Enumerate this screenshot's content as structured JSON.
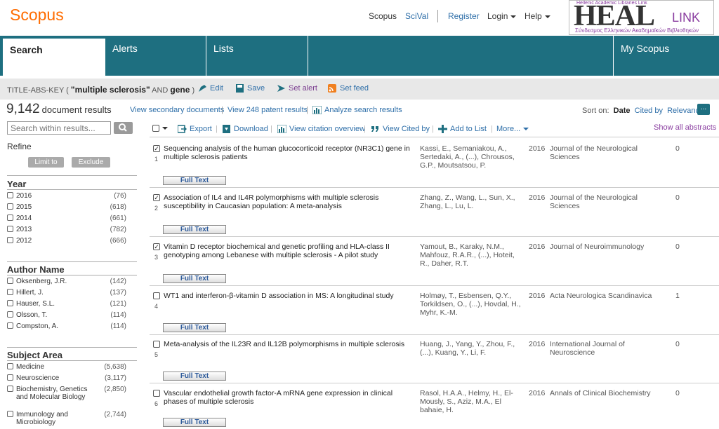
{
  "header": {
    "logo": "Scopus",
    "nav": {
      "scopus": "Scopus",
      "scival": "SciVal",
      "register": "Register",
      "login": "Login",
      "help": "Help"
    },
    "heal": {
      "top_text": "Hellenic Academic Libraries Link",
      "big": "HEAL",
      "link": "LINK",
      "sub": "Σύνδεσμος Ελληνικών Ακαδημαϊκών Βιβλιοθηκών"
    }
  },
  "navbar": {
    "search": "Search",
    "alerts": "Alerts",
    "lists": "Lists",
    "myscopus": "My Scopus"
  },
  "query": {
    "prefix": "TITLE-ABS-KEY",
    "term1": "\"multiple sclerosis\"",
    "operator": "AND",
    "term2": "gene",
    "edit": "Edit",
    "save": "Save",
    "set_alert": "Set alert",
    "set_feed": "Set feed"
  },
  "results": {
    "count": "9,142",
    "label": "document results",
    "secondary": "View secondary documents",
    "patents": "View 248 patent results",
    "analyze": "Analyze search results",
    "sort_label": "Sort on:",
    "sort_date": "Date",
    "sort_cited": "Cited by",
    "sort_relevance": "Relevance",
    "more_icon": "..."
  },
  "sidebar": {
    "search_placeholder": "Search within results...",
    "refine": "Refine",
    "limit_to": "Limit to",
    "exclude": "Exclude",
    "year_title": "Year",
    "years": [
      {
        "label": "2016",
        "count": "(76)"
      },
      {
        "label": "2015",
        "count": "(618)"
      },
      {
        "label": "2014",
        "count": "(661)"
      },
      {
        "label": "2013",
        "count": "(782)"
      },
      {
        "label": "2012",
        "count": "(666)"
      }
    ],
    "author_title": "Author Name",
    "authors": [
      {
        "label": "Oksenberg, J.R.",
        "count": "(142)"
      },
      {
        "label": "Hillert, J.",
        "count": "(137)"
      },
      {
        "label": "Hauser, S.L.",
        "count": "(121)"
      },
      {
        "label": "Olsson, T.",
        "count": "(114)"
      },
      {
        "label": "Compston, A.",
        "count": "(114)"
      }
    ],
    "subject_title": "Subject Area",
    "subjects": [
      {
        "label": "Medicine",
        "count": "(5,638)"
      },
      {
        "label": "Neuroscience",
        "count": "(3,117)"
      },
      {
        "label": "Biochemistry, Genetics and Molecular Biology",
        "count": "(2,850)"
      },
      {
        "label": "Immunology and Microbiology",
        "count": "(2,744)"
      }
    ]
  },
  "toolbar": {
    "export": "Export",
    "download": "Download",
    "citation": "View citation overview",
    "cited_by": "View Cited by",
    "add_list": "Add to List",
    "more": "More...",
    "show_all": "Show all abstracts"
  },
  "rows": [
    {
      "num": "1",
      "checked": true,
      "title": "Sequencing analysis of the human glucocorticoid receptor (NR3C1) gene in multiple sclerosis patients",
      "authors": "Kassi, E., Semaniakou, A., Sertedaki, A., (...), Chrousos, G.P., Moutsatsou, P.",
      "year": "2016",
      "journal": "Journal of the Neurological Sciences",
      "cited": "0",
      "full_text": "Full Text"
    },
    {
      "num": "2",
      "checked": true,
      "title": "Association of IL4 and IL4R polymorphisms with multiple sclerosis susceptibility in Caucasian population: A meta-analysis",
      "authors": "Zhang, Z., Wang, L., Sun, X., Zhang, L., Lu, L.",
      "year": "2016",
      "journal": "Journal of the Neurological Sciences",
      "cited": "0",
      "full_text": "Full Text"
    },
    {
      "num": "3",
      "checked": true,
      "title": "Vitamin D receptor biochemical and genetic profiling and HLA-class II genotyping among Lebanese with multiple sclerosis - A pilot study",
      "authors": "Yamout, B., Karaky, N.M., Mahfouz, R.A.R., (...), Hoteit, R., Daher, R.T.",
      "year": "2016",
      "journal": "Journal of Neuroimmunology",
      "cited": "0",
      "full_text": "Full Text"
    },
    {
      "num": "4",
      "checked": false,
      "title": "WT1 and interferon-β-vitamin D association in MS: A longitudinal study",
      "authors": "Holmøy, T., Esbensen, Q.Y., Torkildsen, O., (...), Hovdal, H., Myhr, K.-M.",
      "year": "2016",
      "journal": "Acta Neurologica Scandinavica",
      "cited": "1",
      "full_text": "Full Text"
    },
    {
      "num": "5",
      "checked": false,
      "title": "Meta-analysis of the IL23R and IL12B polymorphisms in multiple sclerosis",
      "authors": "Huang, J., Yang, Y., Zhou, F., (...), Kuang, Y., Li, F.",
      "year": "2016",
      "journal": "International Journal of Neuroscience",
      "cited": "0",
      "full_text": "Full Text"
    },
    {
      "num": "6",
      "checked": false,
      "title": "Vascular endothelial growth factor-A mRNA gene expression in clinical phases of multiple sclerosis",
      "authors": "Rasol, H.A.A., Helmy, H., El-Mously, S., Aziz, M.A., El bahaie, H.",
      "year": "2016",
      "journal": "Annals of Clinical Biochemistry",
      "cited": "0",
      "full_text": "Full Text"
    }
  ]
}
